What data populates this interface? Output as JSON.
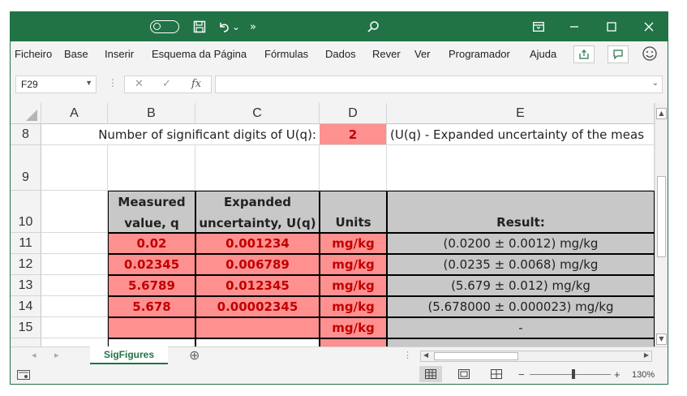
{
  "app": {
    "accent": "#217346"
  },
  "titlebar": {
    "icons": [
      "autosave-toggle",
      "save-icon",
      "undo-icon",
      "undo-dropdown-icon",
      "more-commands-icon",
      "search-icon",
      "ribbon-display-icon",
      "minimize-icon",
      "maximize-icon",
      "close-icon"
    ],
    "undo_dd": "⌄",
    "more": "»"
  },
  "menu": {
    "items": [
      "Ficheiro",
      "Base",
      "Inserir",
      "Esquema da Página",
      "Fórmulas",
      "Dados",
      "Rever",
      "Ver",
      "Programador",
      "Ajuda"
    ]
  },
  "formula_bar": {
    "name_box": "F29",
    "cancel": "✕",
    "enter": "✓",
    "fx": "fx",
    "value": ""
  },
  "columns": [
    "A",
    "B",
    "C",
    "D",
    "E"
  ],
  "rows": {
    "r8": {
      "num": "8",
      "label": "Number of significant digits of U(q):",
      "digits": "2",
      "note": "(U(q) - Expanded uncertainty of the meas"
    },
    "r9": {
      "num": "9"
    },
    "r10": {
      "num": "10",
      "b_line1": "Measured",
      "b_line2": "value, q",
      "c_line1": "Expanded",
      "c_line2": "uncertainty, U(q)",
      "d": "Units",
      "e": "Result:"
    },
    "data": [
      {
        "num": "11",
        "value": "0.02",
        "uncertainty": "0.001234",
        "units": "mg/kg",
        "result": "(0.0200 ± 0.0012) mg/kg"
      },
      {
        "num": "12",
        "value": "0.02345",
        "uncertainty": "0.006789",
        "units": "mg/kg",
        "result": "(0.0235 ± 0.0068) mg/kg"
      },
      {
        "num": "13",
        "value": "5.6789",
        "uncertainty": "0.012345",
        "units": "mg/kg",
        "result": "(5.679 ± 0.012) mg/kg"
      },
      {
        "num": "14",
        "value": "5.678",
        "uncertainty": "0.00002345",
        "units": "mg/kg",
        "result": "(5.678000 ± 0.000023) mg/kg"
      },
      {
        "num": "15",
        "value": "",
        "uncertainty": "",
        "units": "mg/kg",
        "result": "-"
      }
    ]
  },
  "sheet_tabs": {
    "active": "SigFigures",
    "add": "⊕"
  },
  "statusbar": {
    "zoom": "130%",
    "minus": "−",
    "plus": "+"
  },
  "colors": {
    "pink_fill": "#ff9090",
    "gray_fill": "#c8c8c8",
    "red_text": "#c00000"
  }
}
